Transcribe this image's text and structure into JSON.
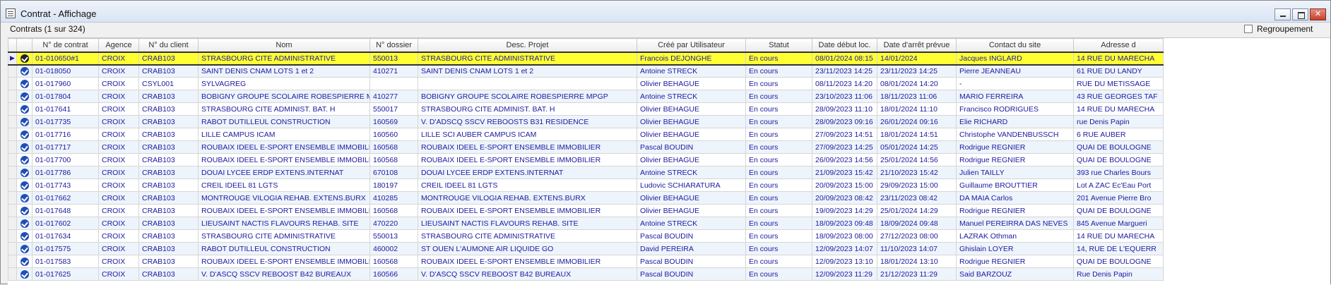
{
  "window": {
    "title": "Contrat - Affichage",
    "controls": [
      "minimize",
      "maximize",
      "close"
    ],
    "close_glyph": "✕"
  },
  "toolbar": {
    "count_label": "Contrats (1 sur 324)",
    "regroupement_label": "Regroupement",
    "regroupement_checked": false
  },
  "grid": {
    "columns": [
      "N° de contrat",
      "Agence",
      "N° du client",
      "Nom",
      "N° dossier",
      "Desc. Projet",
      "Créé par Utilisateur",
      "Statut",
      "Date début loc.",
      "Date d'arrêt prévue",
      "Contact du site",
      "Adresse d"
    ],
    "selected_row": 0,
    "selected_pointer": "▶",
    "rows": [
      [
        "01-010650#1",
        "CROIX",
        "CRAB103",
        "STRASBOURG CITE ADMINISTRATIVE",
        "550013",
        "STRASBOURG CITE ADMINISTRATIVE",
        "Francois DEJONGHE",
        "En cours",
        "08/01/2024 08:15",
        "14/01/2024",
        "Jacques INGLARD",
        "14 RUE DU MARECHA"
      ],
      [
        "01-018050",
        "CROIX",
        "CRAB103",
        "SAINT DENIS CNAM LOTS 1 et 2",
        "410271",
        "SAINT DENIS CNAM LOTS 1 et 2",
        "Antoine STRECK",
        "En cours",
        "23/11/2023 14:25",
        "23/11/2023 14:25",
        "Pierre JEANNEAU",
        "61 RUE DU LANDY"
      ],
      [
        "01-017960",
        "CROIX",
        "CSYL001",
        "SYLVAGREG",
        "",
        "",
        "Olivier BEHAGUE",
        "En cours",
        "08/11/2023 14:20",
        "08/01/2024 14:20",
        "-",
        "RUE DU METISSAGE"
      ],
      [
        "01-017804",
        "CROIX",
        "CRAB103",
        "BOBIGNY GROUPE SCOLAIRE ROBESPIERRE MPGP",
        "410277",
        "BOBIGNY GROUPE SCOLAIRE ROBESPIERRE MPGP",
        "Antoine STRECK",
        "En cours",
        "23/10/2023 11:06",
        "18/11/2023 11:06",
        "MARIO FERREIRA",
        "43 RUE GEORGES TAF"
      ],
      [
        "01-017641",
        "CROIX",
        "CRAB103",
        "STRASBOURG CITE ADMINIST. BAT. H",
        "550017",
        "STRASBOURG CITE ADMINIST. BAT. H",
        "Olivier BEHAGUE",
        "En cours",
        "28/09/2023 11:10",
        "18/01/2024 11:10",
        "Francisco RODRIGUES",
        "14 RUE DU MARECHA"
      ],
      [
        "01-017735",
        "CROIX",
        "CRAB103",
        "RABOT DUTILLEUL CONSTRUCTION",
        "160569",
        "V. D'ADSCQ SSCV REBOOSTS B31 RESIDENCE",
        "Olivier BEHAGUE",
        "En cours",
        "28/09/2023 09:16",
        "26/01/2024 09:16",
        "Elie RICHARD",
        "rue Denis Papin"
      ],
      [
        "01-017716",
        "CROIX",
        "CRAB103",
        "LILLE CAMPUS ICAM",
        "160560",
        "LILLE SCI AUBER CAMPUS ICAM",
        "Olivier BEHAGUE",
        "En cours",
        "27/09/2023 14:51",
        "18/01/2024 14:51",
        "Christophe VANDENBUSSCH",
        "6 RUE AUBER"
      ],
      [
        "01-017717",
        "CROIX",
        "CRAB103",
        "ROUBAIX IDEEL E-SPORT ENSEMBLE IMMOBILIER",
        "160568",
        "ROUBAIX IDEEL E-SPORT ENSEMBLE IMMOBILIER",
        "Pascal BOUDIN",
        "En cours",
        "27/09/2023 14:25",
        "05/01/2024 14:25",
        "Rodrigue REGNIER",
        "QUAI DE BOULOGNE"
      ],
      [
        "01-017700",
        "CROIX",
        "CRAB103",
        "ROUBAIX IDEEL E-SPORT ENSEMBLE IMMOBILIER",
        "160568",
        "ROUBAIX IDEEL E-SPORT ENSEMBLE IMMOBILIER",
        "Olivier BEHAGUE",
        "En cours",
        "26/09/2023 14:56",
        "25/01/2024 14:56",
        "Rodrigue REGNIER",
        "QUAI DE BOULOGNE"
      ],
      [
        "01-017786",
        "CROIX",
        "CRAB103",
        "DOUAI LYCEE ERDP EXTENS.INTERNAT",
        "670108",
        "DOUAI LYCEE ERDP EXTENS.INTERNAT",
        "Antoine STRECK",
        "En cours",
        "21/09/2023 15:42",
        "21/10/2023 15:42",
        "Julien TAILLY",
        "393 rue Charles Bours"
      ],
      [
        "01-017743",
        "CROIX",
        "CRAB103",
        "CREIL IDEEL 81 LGTS",
        "180197",
        "CREIL IDEEL 81 LGTS",
        "Ludovic SCHIARATURA",
        "En cours",
        "20/09/2023 15:00",
        "29/09/2023 15:00",
        "Guillaume BROUTTIER",
        "Lot A ZAC Ec'Eau Port"
      ],
      [
        "01-017662",
        "CROIX",
        "CRAB103",
        "MONTROUGE VILOGIA REHAB. EXTENS.BURX",
        "410285",
        "MONTROUGE VILOGIA REHAB. EXTENS.BURX",
        "Olivier BEHAGUE",
        "En cours",
        "20/09/2023 08:42",
        "23/11/2023 08:42",
        "DA MAIA Carlos",
        "201 Avenue Pierre Bro"
      ],
      [
        "01-017648",
        "CROIX",
        "CRAB103",
        "ROUBAIX IDEEL E-SPORT ENSEMBLE IMMOBILIER",
        "160568",
        "ROUBAIX IDEEL E-SPORT ENSEMBLE IMMOBILIER",
        "Olivier BEHAGUE",
        "En cours",
        "19/09/2023 14:29",
        "25/01/2024 14:29",
        "Rodrigue REGNIER",
        "QUAI DE BOULOGNE"
      ],
      [
        "01-017602",
        "CROIX",
        "CRAB103",
        "LIEUSAINT NACTIS FLAVOURS REHAB. SITE",
        "470220",
        "LIEUSAINT NACTIS FLAVOURS REHAB. SITE",
        "Antoine STRECK",
        "En cours",
        "18/09/2023 09:48",
        "18/09/2024 09:48",
        "Manuel PEREIRRA DAS NEVES",
        "845 Avenue Margueri"
      ],
      [
        "01-017634",
        "CROIX",
        "CRAB103",
        "STRASBOURG CITE ADMINISTRATIVE",
        "550013",
        "STRASBOURG CITE ADMINISTRATIVE",
        "Pascal BOUDIN",
        "En cours",
        "18/09/2023 08:00",
        "27/12/2023 08:00",
        "LAZRAK Othman",
        "14 RUE DU MARECHA"
      ],
      [
        "01-017575",
        "CROIX",
        "CRAB103",
        "RABOT DUTILLEUL CONSTRUCTION",
        "460002",
        "ST OUEN L'AUMONE AIR LIQUIDE GO",
        "David PEREIRA",
        "En cours",
        "12/09/2023 14:07",
        "11/10/2023 14:07",
        "Ghislain LOYER",
        "14, RUE DE L'EQUERR"
      ],
      [
        "01-017583",
        "CROIX",
        "CRAB103",
        "ROUBAIX IDEEL E-SPORT ENSEMBLE IMMOBILIER",
        "160568",
        "ROUBAIX IDEEL E-SPORT ENSEMBLE IMMOBILIER",
        "Pascal BOUDIN",
        "En cours",
        "12/09/2023 13:10",
        "18/01/2024 13:10",
        "Rodrigue REGNIER",
        "QUAI DE BOULOGNE"
      ],
      [
        "01-017625",
        "CROIX",
        "CRAB103",
        "V. D'ASCQ SSCV REBOOST B42 BUREAUX",
        "160566",
        "V. D'ASCQ SSCV REBOOST B42 BUREAUX",
        "Pascal BOUDIN",
        "En cours",
        "12/09/2023 11:29",
        "21/12/2023 11:29",
        "Said BARZOUZ",
        "Rue Denis Papin"
      ]
    ]
  },
  "colors": {
    "selected_row": "#ffff33",
    "row_text": "#1a1aa0",
    "check_icon": "#1f4fb4"
  }
}
